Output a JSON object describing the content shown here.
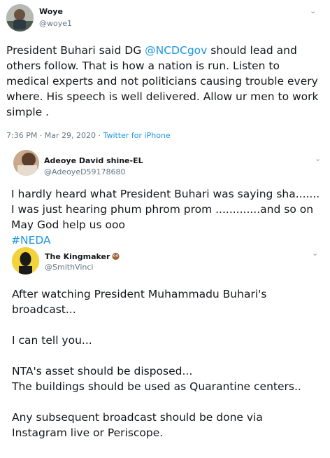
{
  "tweets": [
    {
      "display_name": "Woye",
      "handle": "@woye1",
      "text_before": "President Buhari said DG ",
      "mention": "@NCDCgov",
      "text_after": " should lead and others follow. That is how a nation is run. Listen to medical experts and not politicians causing trouble every where. His speech is well delivered. Allow ur men to work simple .",
      "timestamp": "7:36 PM · Mar 29, 2020",
      "separator": " · ",
      "source": "Twitter for iPhone"
    },
    {
      "display_name": "Adeoye David shine-EL",
      "handle": "@AdeoyeD59178680",
      "text": "I hardly heard what President Buhari was saying sha.......\nI was just hearing phum phrom prom .............and so on\nMay God help us ooo",
      "hashtag_partial": "#NEDA"
    },
    {
      "display_name": "The Kingmaker",
      "name_emoji_icon": "owl-emoji-icon",
      "handle": "@SmithVinci",
      "text": "After watching President Muhammadu Buhari's broadcast...\n\nI can tell you...\n\nNTA's asset should be disposed...\nThe buildings should be used as Quarantine centers..\n\nAny subsequent broadcast should be done via Instagram live or Periscope."
    }
  ],
  "colors": {
    "link": "#1b95e0",
    "secondary_text": "#657786",
    "avatar3_bg": "#f3d23a"
  }
}
